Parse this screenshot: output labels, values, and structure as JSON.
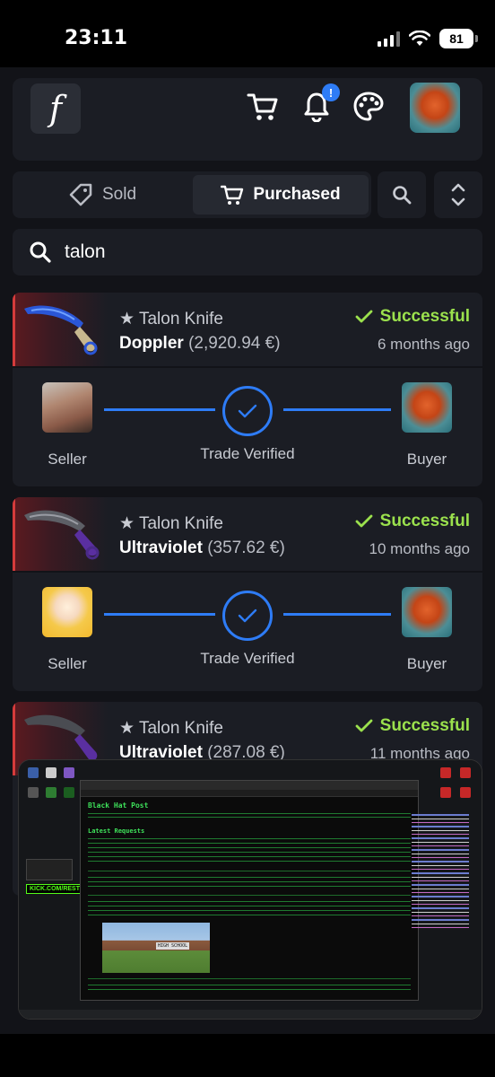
{
  "status_bar": {
    "time": "23:11",
    "battery": "81"
  },
  "header": {
    "logo": "f",
    "notification_badge": "!"
  },
  "tabs": {
    "sold": "Sold",
    "purchased": "Purchased"
  },
  "search": {
    "value": "talon"
  },
  "trades": [
    {
      "item": "★ Talon Knife",
      "skin": "Doppler",
      "price": "(2,920.94 €)",
      "status": "Successful",
      "time": "6 months ago",
      "seller_label": "Seller",
      "verified_label": "Trade Verified",
      "buyer_label": "Buyer"
    },
    {
      "item": "★ Talon Knife",
      "skin": "Ultraviolet",
      "price": "(357.62 €)",
      "status": "Successful",
      "time": "10 months ago",
      "seller_label": "Seller",
      "verified_label": "Trade Verified",
      "buyer_label": "Buyer"
    },
    {
      "item": "★ Talon Knife",
      "skin": "Ultraviolet",
      "price": "(287.08 €)",
      "status": "Successful",
      "time": "11 months ago"
    }
  ],
  "pip": {
    "page_title": "Black Hat Post",
    "section_title": "Latest Requests",
    "kick_label": "KICK.COM/RESTT",
    "photo_sign": "HIGH SCHOOL"
  },
  "colors": {
    "accent": "#2e7cf6",
    "success": "#9be14d",
    "card_bg": "#1b1d24",
    "app_bg": "#121318",
    "danger_stripe": "#d53b3b"
  }
}
